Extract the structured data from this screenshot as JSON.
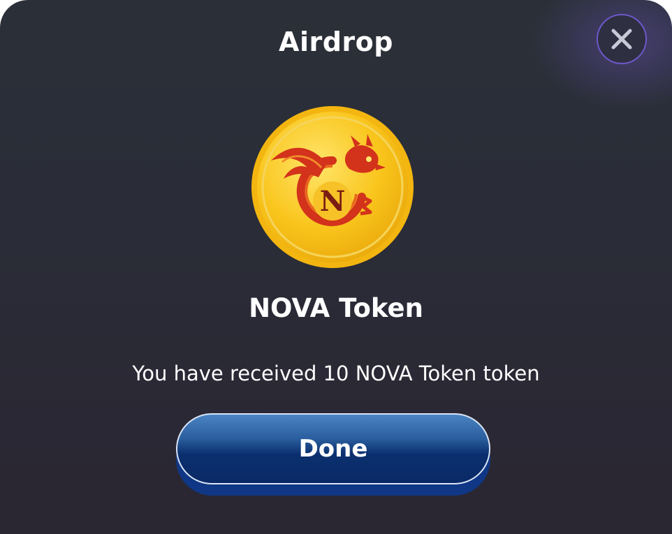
{
  "dialog": {
    "title": "Airdrop",
    "close_icon": "close-icon",
    "token_icon": "nova-token-coin-icon",
    "token_name": "NOVA Token",
    "message": "You have received 10 NOVA Token token",
    "done_label": "Done"
  },
  "colors": {
    "background": "#2a2c37",
    "accent_purple": "#6d58c9",
    "coin_gold": "#f7c21a",
    "dragon_red": "#d3321b",
    "button_blue": "#0b2f6e"
  }
}
